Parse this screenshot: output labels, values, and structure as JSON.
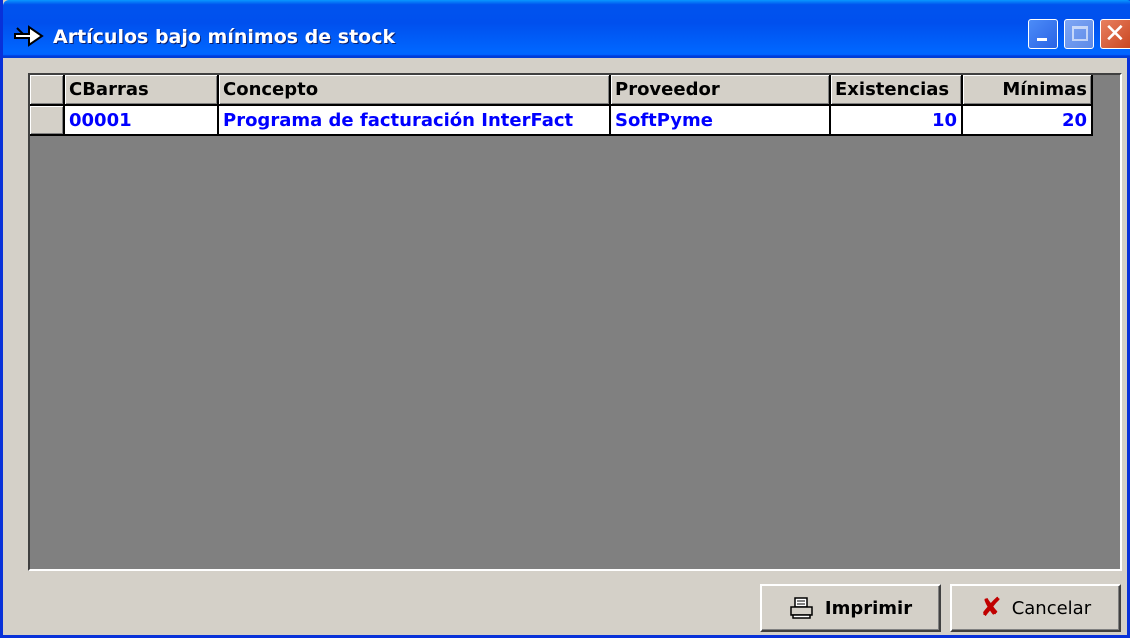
{
  "window": {
    "title": "Artículos bajo mínimos de stock",
    "controls": {
      "minimize": "minimize",
      "maximize": "maximize",
      "close": "close"
    }
  },
  "grid": {
    "columns": [
      "CBarras",
      "Concepto",
      "Proveedor",
      "Existencias",
      "Mínimas"
    ],
    "rows": [
      {
        "cbarras": "00001",
        "concepto": "Programa de facturación InterFact",
        "proveedor": "SoftPyme",
        "existencias": "10",
        "minimas": "20"
      }
    ]
  },
  "buttons": {
    "print_label": "Imprimir",
    "cancel_label": "Cancelar"
  },
  "colors": {
    "titlebar": "#0050ee",
    "row_text": "#0000ff",
    "grid_background": "#808080",
    "cancel_icon": "#c00000"
  },
  "icons": {
    "app": "arrow-icon",
    "print": "printer-icon",
    "cancel": "x-mark-icon"
  }
}
